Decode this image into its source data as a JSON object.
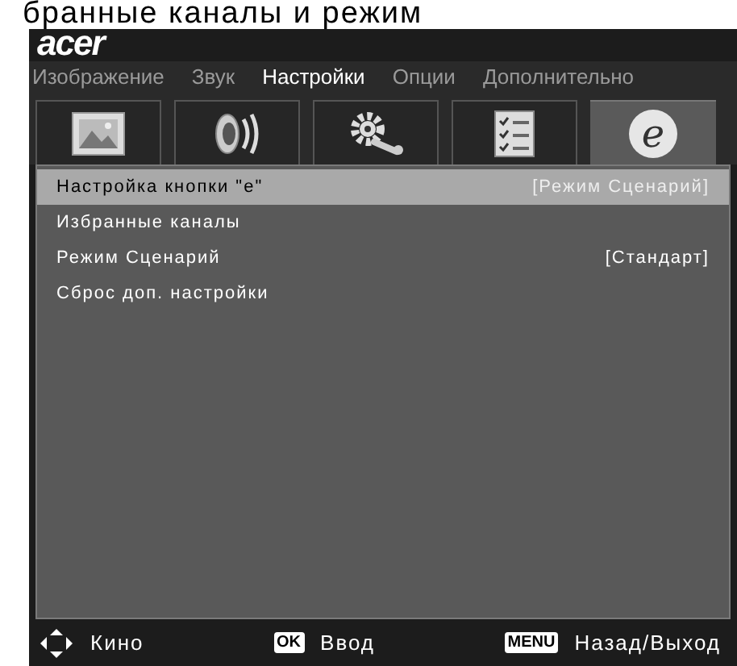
{
  "heading": "бранные каналы и режим",
  "logo": "acer",
  "tabs": [
    {
      "label": "Изображение",
      "selected": false
    },
    {
      "label": "Звук",
      "selected": false
    },
    {
      "label": "Настройки",
      "selected": true
    },
    {
      "label": "Опции",
      "selected": false
    },
    {
      "label": "Дополнительно",
      "selected": false
    }
  ],
  "icon_tabs": [
    {
      "kind": "picture",
      "selected": false
    },
    {
      "kind": "speaker",
      "selected": false
    },
    {
      "kind": "gear",
      "selected": false
    },
    {
      "kind": "checklist",
      "selected": false
    },
    {
      "kind": "glyph",
      "glyph": "e",
      "selected": true
    }
  ],
  "menu": [
    {
      "label": "Настройка кнопки \"e\"",
      "value": "[Режим Сценарий]",
      "selected": true
    },
    {
      "label": "Избранные каналы",
      "selected": false
    },
    {
      "label": "Режим Сценарий",
      "value": "[Стандарт]",
      "selected": false
    },
    {
      "label": "Сброс доп. настройки",
      "selected": false
    }
  ],
  "footer": [
    {
      "kind": "arrows",
      "label": "Кино"
    },
    {
      "kind": "key",
      "key": "OK",
      "label": "Ввод"
    },
    {
      "kind": "key",
      "key": "MENU",
      "label": "Назад/Выход"
    }
  ]
}
